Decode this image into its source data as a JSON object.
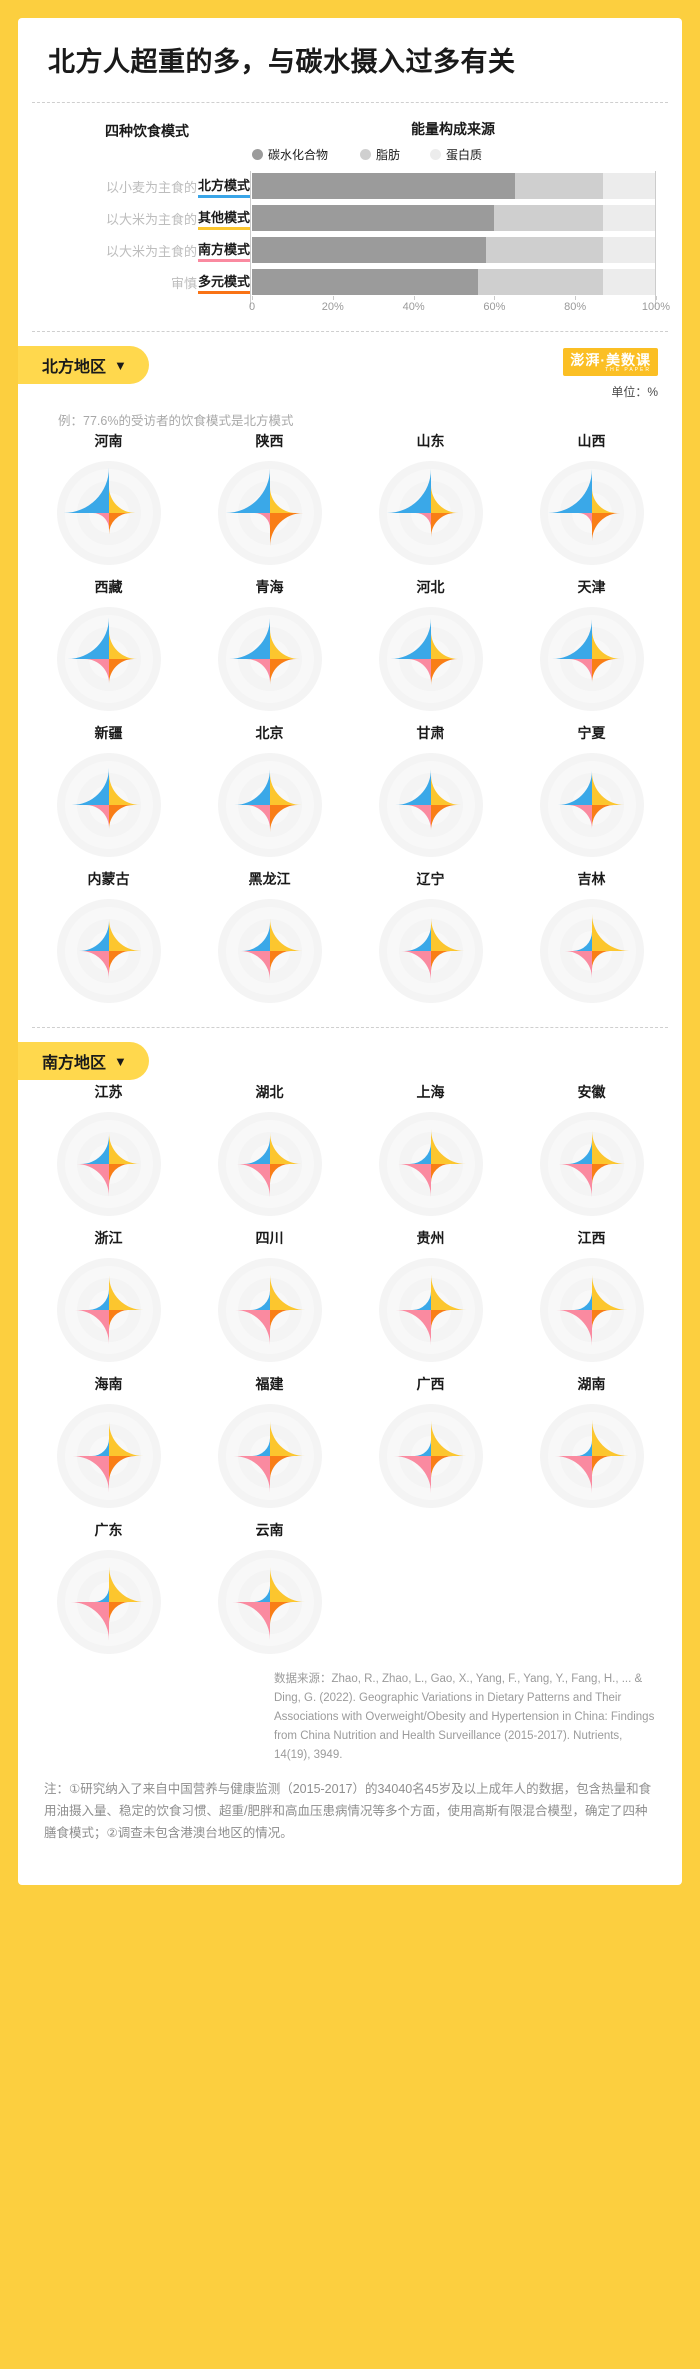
{
  "title": "北方人超重的多，与碳水摄入过多有关",
  "bar_section": {
    "left_header": "四种饮食模式",
    "right_header": "能量构成来源",
    "legend": [
      {
        "label": "碳水化合物",
        "color": "#9b9b9b",
        "key": "carb"
      },
      {
        "label": "脂肪",
        "color": "#cfcfcf",
        "key": "fat"
      },
      {
        "label": "蛋白质",
        "color": "#ececec",
        "key": "prot"
      }
    ]
  },
  "chart_data": [
    {
      "type": "bar",
      "title": "能量构成来源",
      "subtype": "stacked-horizontal-100",
      "categories": [
        "北方模式",
        "其他模式",
        "南方模式",
        "多元模式"
      ],
      "category_prefixes": [
        "以小麦为主食的",
        "以大米为主食的",
        "以大米为主食的",
        "审慎"
      ],
      "category_underline_colors": [
        "#39a5e8",
        "#fcc62e",
        "#fa8aa0",
        "#f97316"
      ],
      "series": [
        {
          "name": "碳水化合物",
          "color": "#9b9b9b",
          "values": [
            65,
            60,
            58,
            56
          ]
        },
        {
          "name": "脂肪",
          "color": "#cfcfcf",
          "values": [
            22,
            27,
            29,
            31
          ]
        },
        {
          "name": "蛋白质",
          "color": "#ececec",
          "values": [
            13,
            13,
            13,
            13
          ]
        }
      ],
      "xlabel": "",
      "ylabel": "",
      "xlim": [
        0,
        100
      ],
      "xticks": [
        "0",
        "20%",
        "40%",
        "60%",
        "80%",
        "100%"
      ],
      "grid": false,
      "legend_position": "top"
    },
    {
      "type": "pie",
      "subtype": "quadrant-radial-grid",
      "title": "各省份四种饮食模式占比",
      "unit": "%",
      "quadrants": [
        {
          "name": "北方模式",
          "color": "#3aa8e8",
          "position": "top-left"
        },
        {
          "name": "其他模式",
          "color": "#fcc62e",
          "position": "top-right"
        },
        {
          "name": "多元模式",
          "color": "#f97e16",
          "position": "bottom-right"
        },
        {
          "name": "南方模式",
          "color": "#fa8aa0",
          "position": "bottom-left"
        }
      ],
      "regions": [
        {
          "region": "北方地区",
          "provinces": [
            {
              "name": "河南",
              "north": 77.6,
              "other": 26,
              "diverse": 17,
              "south": 10
            },
            {
              "name": "陕西",
              "north": 74,
              "other": 25,
              "diverse": 42,
              "south": 9
            },
            {
              "name": "山东",
              "north": 73,
              "other": 29,
              "diverse": 22,
              "south": 9
            },
            {
              "name": "山西",
              "north": 72,
              "other": 23,
              "diverse": 30,
              "south": 7
            },
            {
              "name": "西藏",
              "north": 65,
              "other": 30,
              "diverse": 23,
              "south": 22
            },
            {
              "name": "青海",
              "north": 63,
              "other": 33,
              "diverse": 25,
              "south": 21
            },
            {
              "name": "河北",
              "north": 62,
              "other": 28,
              "diverse": 26,
              "south": 21
            },
            {
              "name": "天津",
              "north": 60,
              "other": 32,
              "diverse": 21,
              "south": 20
            },
            {
              "name": "新疆",
              "north": 52,
              "other": 37,
              "diverse": 22,
              "south": 20
            },
            {
              "name": "北京",
              "north": 48,
              "other": 38,
              "diverse": 28,
              "south": 22
            },
            {
              "name": "甘肃",
              "north": 48,
              "other": 34,
              "diverse": 24,
              "south": 24
            },
            {
              "name": "宁夏",
              "north": 44,
              "other": 40,
              "diverse": 18,
              "south": 22
            },
            {
              "name": "内蒙古",
              "north": 34,
              "other": 39,
              "diverse": 17,
              "south": 30
            },
            {
              "name": "黑龙江",
              "north": 30,
              "other": 40,
              "diverse": 16,
              "south": 33
            },
            {
              "name": "辽宁",
              "north": 26,
              "other": 42,
              "diverse": 15,
              "south": 34
            },
            {
              "name": "吉林",
              "north": 14,
              "other": 52,
              "diverse": 12,
              "south": 28
            }
          ]
        },
        {
          "region": "南方地区",
          "provinces": [
            {
              "name": "江苏",
              "north": 30,
              "other": 36,
              "diverse": 16,
              "south": 40
            },
            {
              "name": "湖北",
              "north": 26,
              "other": 37,
              "diverse": 14,
              "south": 42
            },
            {
              "name": "上海",
              "north": 17,
              "other": 46,
              "diverse": 13,
              "south": 41
            },
            {
              "name": "安徽",
              "north": 22,
              "other": 42,
              "diverse": 16,
              "south": 42
            },
            {
              "name": "浙江",
              "north": 16,
              "other": 45,
              "diverse": 14,
              "south": 44
            },
            {
              "name": "四川",
              "north": 14,
              "other": 47,
              "diverse": 15,
              "south": 46
            },
            {
              "name": "贵州",
              "north": 13,
              "other": 48,
              "diverse": 14,
              "south": 47
            },
            {
              "name": "江西",
              "north": 12,
              "other": 47,
              "diverse": 13,
              "south": 48
            },
            {
              "name": "海南",
              "north": 11,
              "other": 44,
              "diverse": 26,
              "south": 50
            },
            {
              "name": "福建",
              "north": 12,
              "other": 46,
              "diverse": 22,
              "south": 50
            },
            {
              "name": "广西",
              "north": 10,
              "other": 47,
              "diverse": 18,
              "south": 52
            },
            {
              "name": "湖南",
              "north": 9,
              "other": 50,
              "diverse": 14,
              "south": 52
            },
            {
              "name": "广东",
              "north": 8,
              "other": 48,
              "diverse": 16,
              "south": 56
            },
            {
              "name": "云南",
              "north": 10,
              "other": 46,
              "diverse": 20,
              "south": 54
            }
          ]
        }
      ]
    }
  ],
  "north_section": {
    "pill_label": "北方地区",
    "caret": "▼",
    "brand": "澎湃·美数课",
    "brand_sub": "THE PAPER",
    "unit": "单位：%",
    "example_note": "例：77.6%的受访者的饮食模式是北方模式"
  },
  "south_section": {
    "pill_label": "南方地区",
    "caret": "▼"
  },
  "footer": {
    "source": "数据来源：Zhao, R., Zhao, L., Gao, X., Yang, F., Yang, Y., Fang, H., ... & Ding, G. (2022). Geographic Variations in Dietary Patterns and Their Associations with Overweight/Obesity and Hypertension in China: Findings from China Nutrition and Health Surveillance (2015-2017). Nutrients, 14(19), 3949.",
    "note": "注：①研究纳入了来自中国营养与健康监测（2015-2017）的34040名45岁及以上成年人的数据，包含热量和食用油摄入量、稳定的饮食习惯、超重/肥胖和高血压患病情况等多个方面，使用高斯有限混合模型，确定了四种膳食模式；②调查未包含港澳台地区的情况。"
  },
  "colors": {
    "page_bg": "#fccf3f",
    "card_bg": "#ffffff",
    "north": "#3aa8e8",
    "other": "#fcc62e",
    "diverse": "#f97e16",
    "south": "#fa8aa0",
    "carb": "#9b9b9b",
    "fat": "#cfcfcf",
    "protein": "#ececec"
  }
}
